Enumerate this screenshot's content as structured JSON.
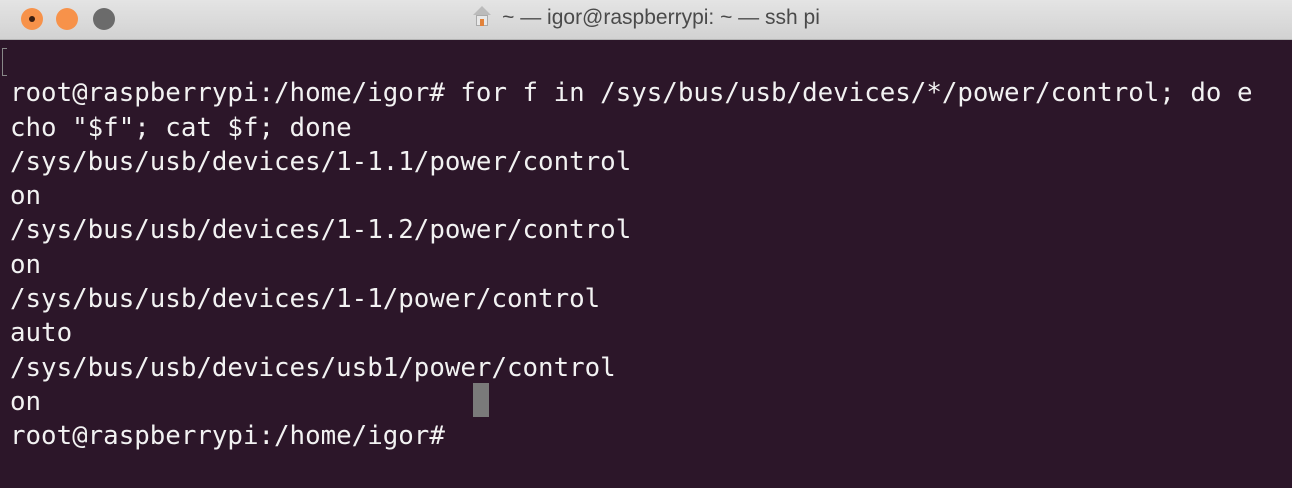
{
  "window": {
    "title": "~ — igor@raspberrypi: ~ — ssh pi",
    "title_icon": "home-icon",
    "buttons": [
      "close",
      "minimize",
      "maximize"
    ]
  },
  "terminal": {
    "lines": [
      "root@raspberrypi:/home/igor# for f in /sys/bus/usb/devices/*/power/control; do e",
      "cho \"$f\"; cat $f; done",
      "/sys/bus/usb/devices/1-1.1/power/control",
      "on",
      "/sys/bus/usb/devices/1-1.2/power/control",
      "on",
      "/sys/bus/usb/devices/1-1/power/control",
      "auto",
      "/sys/bus/usb/devices/usb1/power/control",
      "on",
      "root@raspberrypi:/home/igor# "
    ]
  },
  "colors": {
    "background": "#2c1629",
    "text": "#f2f2f2",
    "cursor": "#7a7a7a"
  }
}
